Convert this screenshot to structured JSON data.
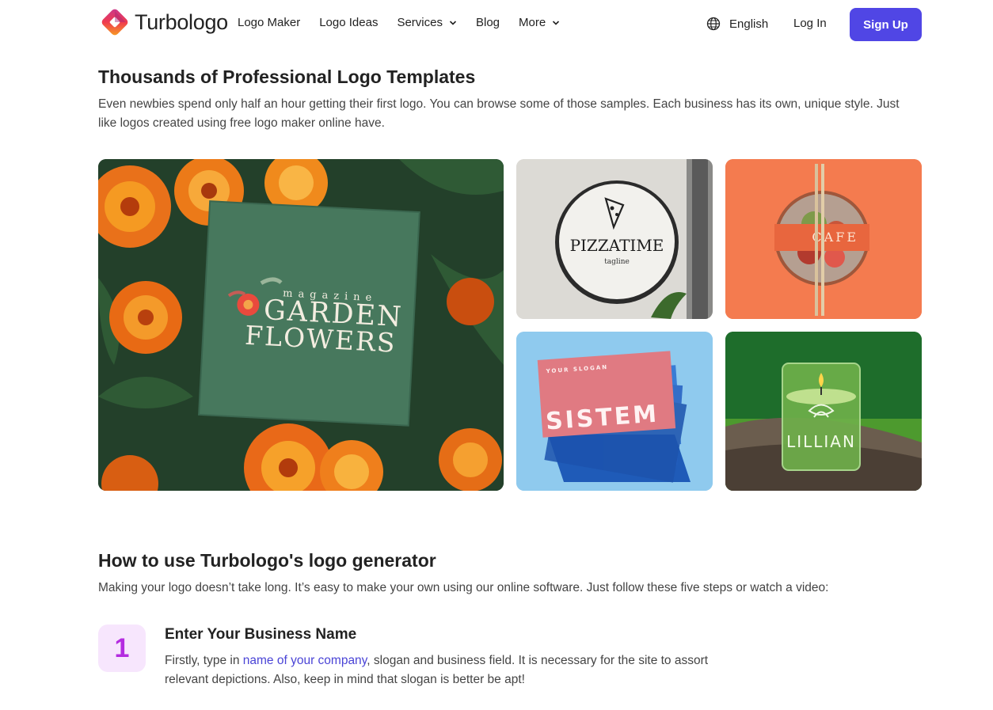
{
  "header": {
    "brand": "Turbologo",
    "nav": [
      {
        "label": "Logo Maker",
        "has_dropdown": false
      },
      {
        "label": "Logo Ideas",
        "has_dropdown": false
      },
      {
        "label": "Services",
        "has_dropdown": true
      },
      {
        "label": "Blog",
        "has_dropdown": false
      },
      {
        "label": "More",
        "has_dropdown": true
      }
    ],
    "language": "English",
    "login": "Log In",
    "signup": "Sign Up",
    "colors": {
      "accent": "#5046e5"
    }
  },
  "templates": {
    "title": "Thousands of Professional Logo Templates",
    "description": "Even newbies spend only half an hour getting their first logo. You can browse some of those samples. Each business has its own, unique style. Just like logos created using free logo maker online have.",
    "samples": [
      {
        "name": "garden",
        "lines": [
          "magazine",
          "GARDEN",
          "FLOWERS"
        ]
      },
      {
        "name": "pizza",
        "lines": [
          "PIZZATIME",
          "tagline"
        ]
      },
      {
        "name": "cafe",
        "lines": [
          "CAFE"
        ]
      },
      {
        "name": "sistem",
        "lines": [
          "YOUR SLOGAN",
          "SISTEM"
        ]
      },
      {
        "name": "lillian",
        "lines": [
          "LILLIAN"
        ]
      }
    ]
  },
  "howto": {
    "title": "How to use Turbologo's logo generator",
    "description": "Making your logo doesn’t take long. It’s easy to make your own using our online software. Just follow these five steps or watch a video:",
    "steps": [
      {
        "number": "1",
        "title": "Enter Your Business Name",
        "text_before": "Firstly, type in ",
        "link": "name of your company",
        "text_after": ", slogan and business field. It is necessary for the site to assort relevant depictions. Also, keep in mind that slogan is better be apt!"
      }
    ]
  }
}
